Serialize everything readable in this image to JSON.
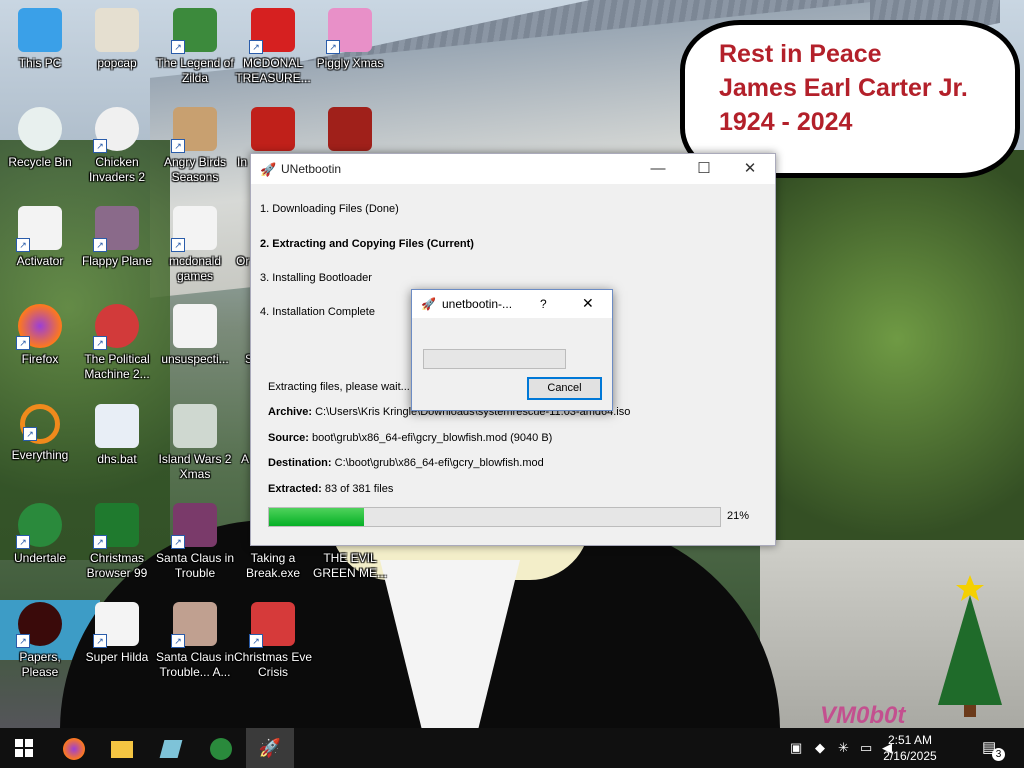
{
  "memorial": {
    "line1": "Rest in Peace",
    "line2": "James Earl Carter Jr.",
    "line3": "1924 - 2024"
  },
  "desktop_icons": [
    {
      "label": "This PC"
    },
    {
      "label": "popcap"
    },
    {
      "label": "The Legend of Zilda"
    },
    {
      "label": "MCDONAL TREASURE..."
    },
    {
      "label": "Piggly Xmas"
    },
    {
      "label": "Recycle Bin"
    },
    {
      "label": "Chicken Invaders 2"
    },
    {
      "label": "Angry Birds Seasons"
    },
    {
      "label": "In"
    },
    {
      "label": "Activator"
    },
    {
      "label": "Flappy Plane"
    },
    {
      "label": "mcdonald games"
    },
    {
      "label": "Or"
    },
    {
      "label": "Firefox"
    },
    {
      "label": "The Political Machine 2..."
    },
    {
      "label": "unsuspecti..."
    },
    {
      "label": "S"
    },
    {
      "label": "Everything"
    },
    {
      "label": "dhs.bat"
    },
    {
      "label": "Island Wars 2 Xmas"
    },
    {
      "label": "A"
    },
    {
      "label": "Undertale"
    },
    {
      "label": "Christmas Browser 99"
    },
    {
      "label": "Santa Claus in Trouble"
    },
    {
      "label": "Taking a Break.exe"
    },
    {
      "label": "THE EVIL GREEN ME..."
    },
    {
      "label": "Papers, Please"
    },
    {
      "label": "Super Hilda"
    },
    {
      "label": "Santa Claus in Trouble... A..."
    },
    {
      "label": "Christmas Eve Crisis"
    }
  ],
  "window": {
    "title": "UNetbootin",
    "steps": [
      "1. Downloading Files (Done)",
      "2. Extracting and Copying Files (Current)",
      "3. Installing Bootloader",
      "4. Installation Complete"
    ],
    "status": "Extracting files, please wait...",
    "archive_label": "Archive:",
    "archive_value": " C:\\Users\\Kris Kringle\\Downloads\\systemrescue-11.03-amd64.iso",
    "source_label": "Source:",
    "source_value": " boot\\grub\\x86_64-efi\\gcry_blowfish.mod (9040 B)",
    "destination_label": "Destination:",
    "destination_value": " C:\\boot\\grub\\x86_64-efi\\gcry_blowfish.mod",
    "extracted_label": "Extracted:",
    "extracted_value": " 83 of 381 files",
    "progress": 0.21,
    "progress_text": "21%"
  },
  "dialog": {
    "title": "unetbootin-...",
    "help": "?",
    "cancel": "Cancel"
  },
  "taskbar": {
    "time": "2:51 AM",
    "date": "2/16/2025",
    "notifications": "3"
  },
  "watermark": "VM0b0t"
}
